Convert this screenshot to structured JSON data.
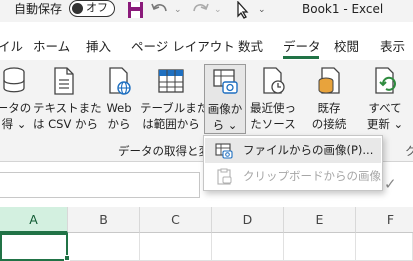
{
  "titlebar": {
    "autosave_label": "自動保存",
    "autosave_state": "オフ",
    "document_title": "Book1 - Excel"
  },
  "tabs": [
    "イル",
    "ホーム",
    "挿入",
    "ページ レイアウト",
    "数式",
    "データ",
    "校閲",
    "表示"
  ],
  "ribbon": {
    "buttons": [
      {
        "label": "ータの\n得 ⌄"
      },
      {
        "label": "テキストまた\nは CSV から"
      },
      {
        "label": "Web\nから"
      },
      {
        "label": "テーブルまた\nは範囲から"
      },
      {
        "label": "画像か\nら ⌄"
      },
      {
        "label": "最近使っ\nたソース"
      },
      {
        "label": "既存\nの接続"
      },
      {
        "label": "すべて\n更新 ⌄"
      }
    ],
    "group_label": "データの取得と変",
    "group_label_next": "ク"
  },
  "menu": {
    "items": [
      {
        "label": "ファイルからの画像(P)...",
        "enabled": true
      },
      {
        "label": "クリップボードからの画像",
        "enabled": false
      }
    ]
  },
  "grid": {
    "columns": [
      "A",
      "B",
      "C",
      "D",
      "E",
      "F"
    ]
  },
  "colors": {
    "accent": "#217346",
    "ribbon_bg": "#f3f3f3",
    "save_icon": "#8a1a7a"
  }
}
